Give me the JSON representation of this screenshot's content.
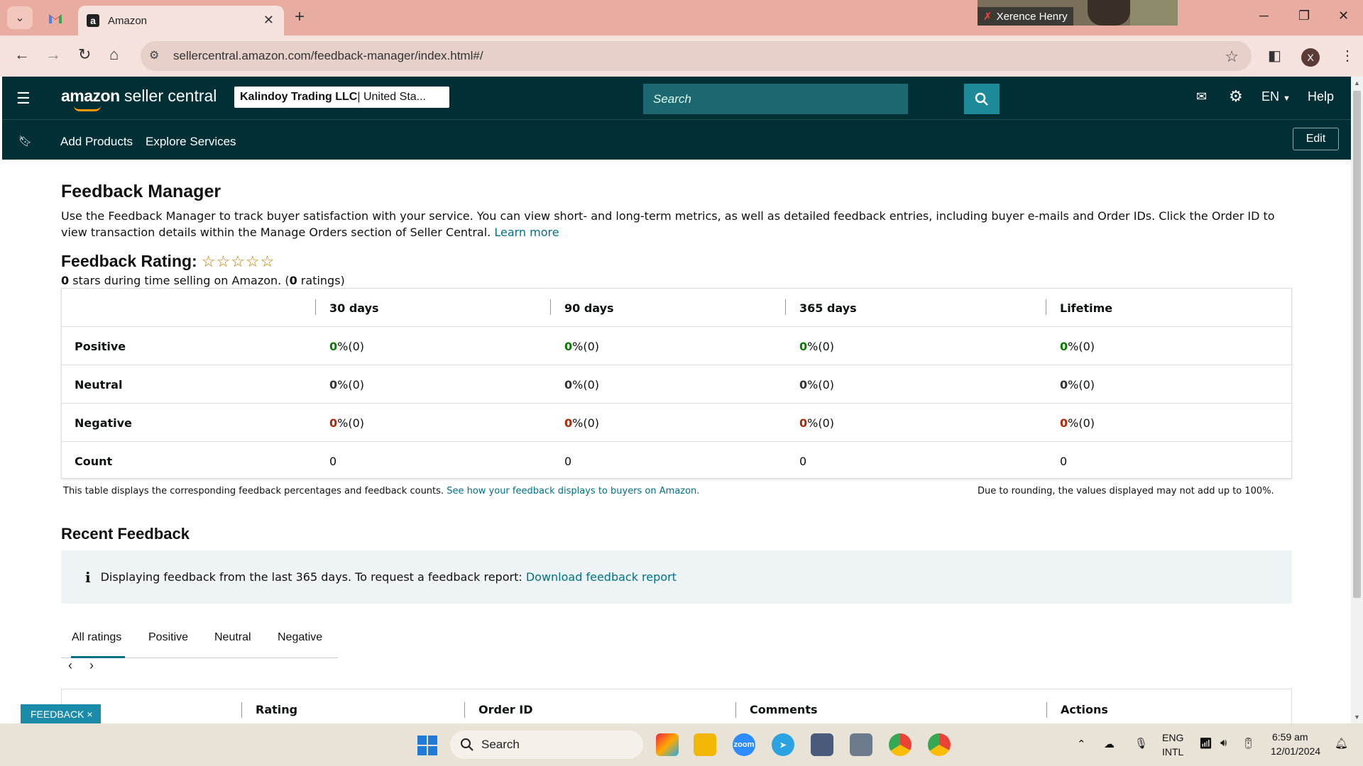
{
  "browser": {
    "tab_title": "Amazon",
    "url": "sellercentral.amazon.com/feedback-manager/index.html#/",
    "video_participant": "Xerence Henry",
    "profile_initial": "X"
  },
  "header": {
    "logo_bold": "amazon",
    "logo_rest": " seller central",
    "account_name": "Kalindoy Trading LLC",
    "account_region": " | United Sta...",
    "search_placeholder": "Search",
    "language": "EN",
    "help": "Help",
    "subnav": [
      "Add Products",
      "Explore Services"
    ],
    "edit": "Edit"
  },
  "page": {
    "title": "Feedback Manager",
    "description": "Use the Feedback Manager to track buyer satisfaction with your service. You can view short- and long-term metrics, as well as detailed feedback entries, including buyer e-mails and Order IDs. Click the Order ID to view transaction details within the Manage Orders section of Seller Central.",
    "learn_more": "Learn more",
    "rating_title": "Feedback Rating:",
    "stars": "☆☆☆☆☆",
    "stars_count": "0",
    "stars_text": " stars during time selling on Amazon. (",
    "ratings_count": "0",
    "ratings_text": " ratings)"
  },
  "metrics": {
    "columns": [
      "30 days",
      "90 days",
      "365 days",
      "Lifetime"
    ],
    "rows": [
      {
        "label": "Positive",
        "values": [
          "0",
          "0",
          "0",
          "0"
        ],
        "suffix": " %(0)"
      },
      {
        "label": "Neutral",
        "values": [
          "0",
          "0",
          "0",
          "0"
        ],
        "suffix": " %(0)"
      },
      {
        "label": "Negative",
        "values": [
          "0",
          "0",
          "0",
          "0"
        ],
        "suffix": " %(0)"
      },
      {
        "label": "Count",
        "values": [
          "0",
          "0",
          "0",
          "0"
        ],
        "suffix": ""
      }
    ],
    "note_left": "This table displays the corresponding feedback percentages and feedback counts.",
    "note_link": "See how your feedback displays to buyers on Amazon.",
    "note_right": "Due to rounding, the values displayed may not add up to 100%."
  },
  "recent": {
    "title": "Recent Feedback",
    "info_text": "Displaying feedback from the last 365 days. To request a feedback report:",
    "info_link": "Download feedback report",
    "tabs": [
      "All ratings",
      "Positive",
      "Neutral",
      "Negative"
    ],
    "columns": [
      ":",
      "Rating",
      "Order ID",
      "Comments",
      "Actions"
    ],
    "feedback_button": "FEEDBACK ×"
  },
  "taskbar": {
    "search": "Search",
    "lang1": "ENG",
    "lang2": "INTL",
    "time": "6:59 am",
    "date": "12/01/2024"
  }
}
